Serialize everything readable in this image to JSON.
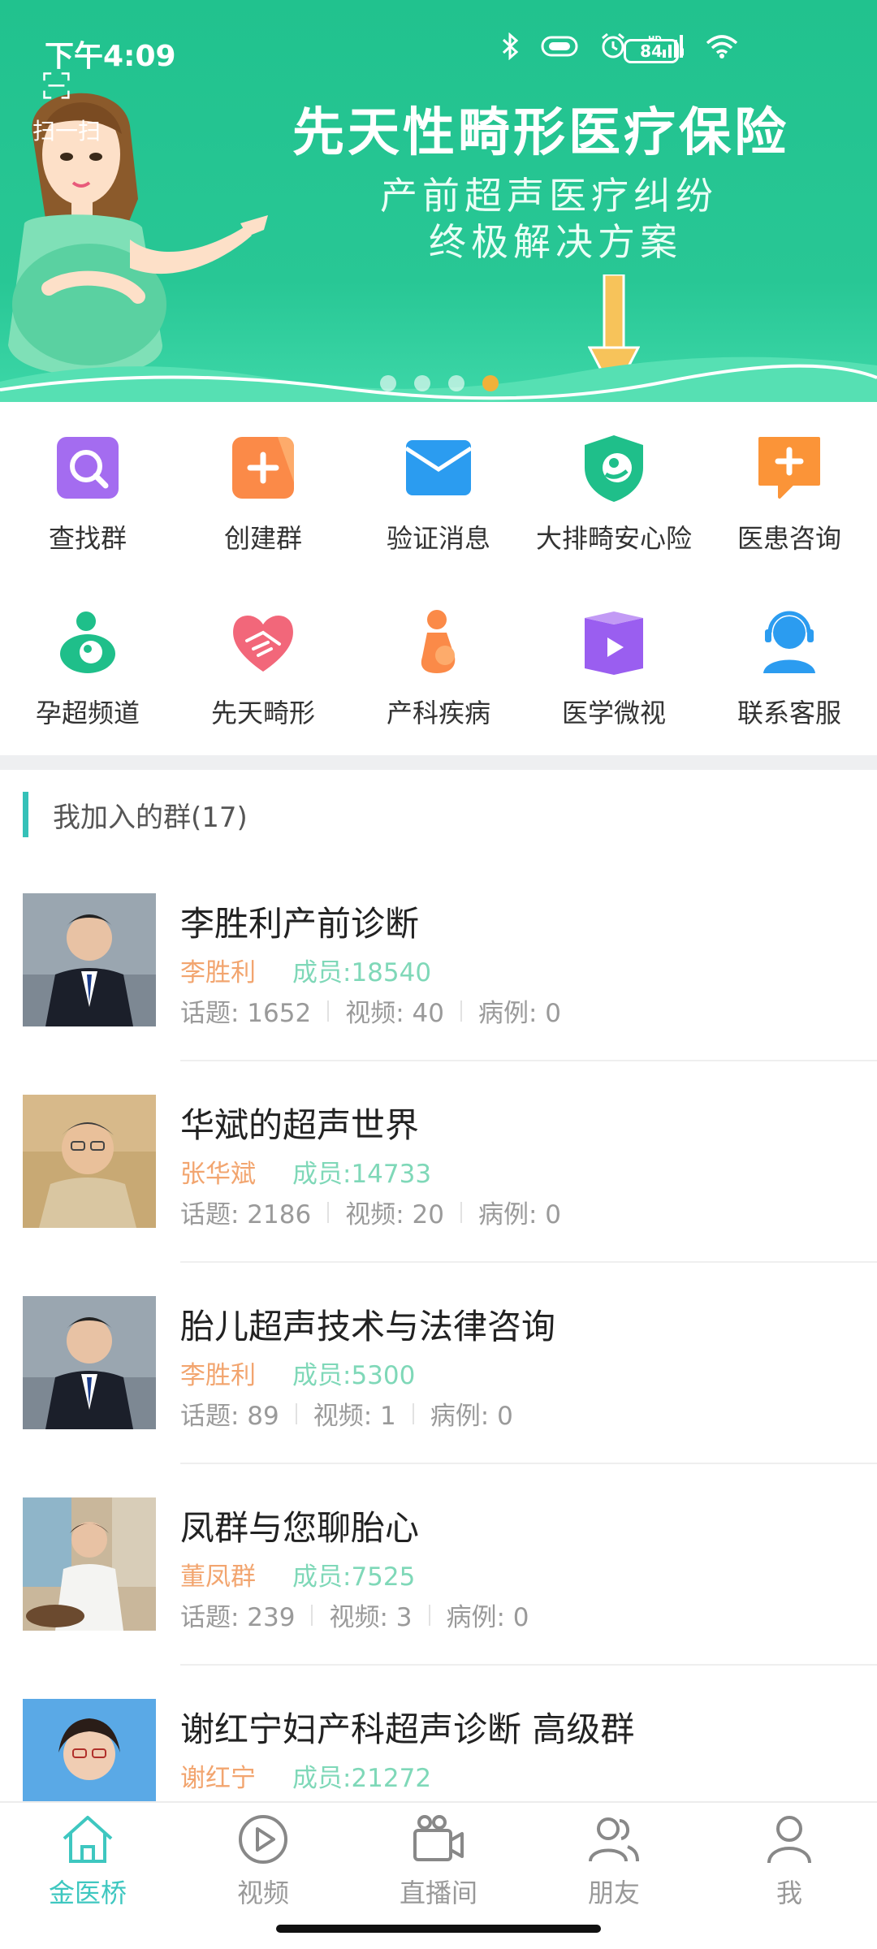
{
  "status_bar": {
    "time": "下午4:09",
    "battery": "84"
  },
  "banner": {
    "scan_label": "扫一扫",
    "title": "先天性畸形医疗保险",
    "subtitle_line1": "产前超声医疗纠纷",
    "subtitle_line2": "终极解决方案",
    "slide_count": 4,
    "active_slide": 4
  },
  "shortcuts": [
    {
      "label": "查找群",
      "icon": "search-icon"
    },
    {
      "label": "创建群",
      "icon": "plus-icon"
    },
    {
      "label": "验证消息",
      "icon": "envelope-icon"
    },
    {
      "label": "大排畸安心险",
      "icon": "shield-baby-icon"
    },
    {
      "label": "医患咨询",
      "icon": "chat-plus-icon"
    },
    {
      "label": "孕超频道",
      "icon": "pregnancy-icon"
    },
    {
      "label": "先天畸形",
      "icon": "heart-hands-icon"
    },
    {
      "label": "产科疾病",
      "icon": "pregnant-woman-icon"
    },
    {
      "label": "医学微视",
      "icon": "video-book-icon"
    },
    {
      "label": "联系客服",
      "icon": "support-agent-icon"
    }
  ],
  "section": {
    "title": "我加入的群(17)"
  },
  "groups": [
    {
      "name": "李胜利产前诊断",
      "owner": "李胜利",
      "members": "成员:18540",
      "topics": "话题: 1652",
      "videos": "视频: 40",
      "cases": "病例: 0"
    },
    {
      "name": "华斌的超声世界",
      "owner": "张华斌",
      "members": "成员:14733",
      "topics": "话题: 2186",
      "videos": "视频: 20",
      "cases": "病例: 0"
    },
    {
      "name": "胎儿超声技术与法律咨询",
      "owner": "李胜利",
      "members": "成员:5300",
      "topics": "话题: 89",
      "videos": "视频: 1",
      "cases": "病例: 0"
    },
    {
      "name": "凤群与您聊胎心",
      "owner": "董凤群",
      "members": "成员:7525",
      "topics": "话题: 239",
      "videos": "视频: 3",
      "cases": "病例: 0"
    },
    {
      "name": "谢红宁妇产科超声诊断 高级群",
      "owner": "谢红宁",
      "members": "成员:21272",
      "topics": "",
      "videos": "",
      "cases": ""
    }
  ],
  "tabs": [
    {
      "label": "金医桥",
      "icon": "home-icon",
      "active": true
    },
    {
      "label": "视频",
      "icon": "play-icon",
      "active": false
    },
    {
      "label": "直播间",
      "icon": "video-camera-icon",
      "active": false
    },
    {
      "label": "朋友",
      "icon": "friends-icon",
      "active": false
    },
    {
      "label": "我",
      "icon": "person-icon",
      "active": false
    }
  ],
  "colors": {
    "brand_green": "#21c28e",
    "accent_teal": "#3ec7c0",
    "owner_orange": "#f2a56f",
    "members_green": "#7fd8b8"
  }
}
